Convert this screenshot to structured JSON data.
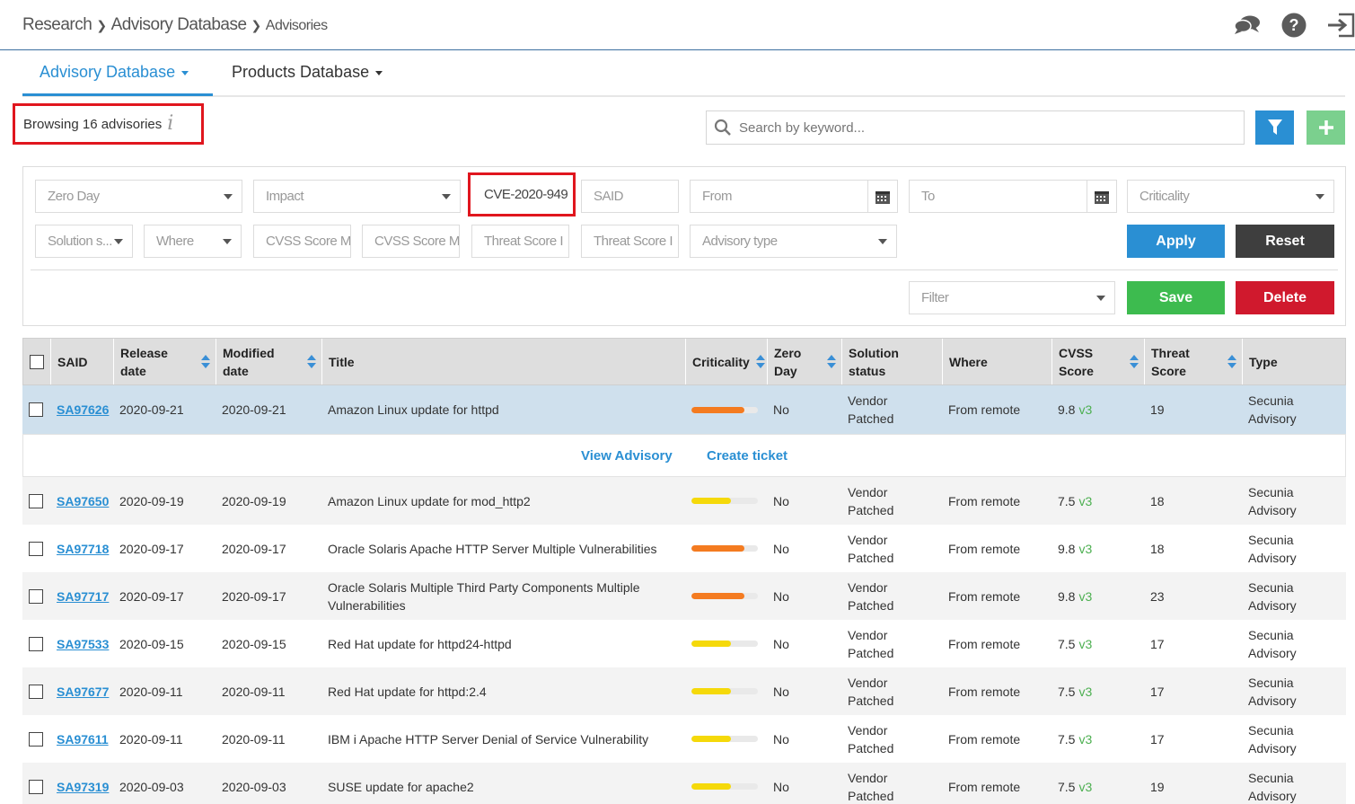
{
  "breadcrumb": {
    "items": [
      "Research",
      "Advisory Database",
      "Advisories"
    ]
  },
  "header_icons": [
    "chat-bubbles-icon",
    "help-icon",
    "logout-icon"
  ],
  "tabs": [
    {
      "label": "Advisory Database",
      "active": true
    },
    {
      "label": "Products Database",
      "active": false
    }
  ],
  "browsing": {
    "text": "Browsing 16 advisories",
    "info_icon": "i"
  },
  "search": {
    "placeholder": "Search by keyword..."
  },
  "filters": {
    "zero_day": "Zero Day",
    "impact": "Impact",
    "cve": "CVE-2020-949",
    "said": "SAID",
    "from": "From",
    "to": "To",
    "criticality": "Criticality",
    "solution_status": "Solution s...",
    "where": "Where",
    "cvss_min": "CVSS Score M",
    "cvss_max": "CVSS Score M",
    "threat_min": "Threat Score I",
    "threat_max": "Threat Score I",
    "advisory_type": "Advisory type",
    "saved_filter": "Filter"
  },
  "buttons": {
    "apply": "Apply",
    "reset": "Reset",
    "save": "Save",
    "delete": "Delete"
  },
  "table": {
    "headers": {
      "said": "SAID",
      "release": "Release date",
      "modified": "Modified date",
      "title": "Title",
      "criticality": "Criticality",
      "zero_day": "Zero Day",
      "solution": "Solution status",
      "where": "Where",
      "cvss": "CVSS Score",
      "threat": "Threat Score",
      "type": "Type"
    },
    "actions": {
      "view": "View Advisory",
      "ticket": "Create ticket"
    },
    "rows": [
      {
        "said": "SA97626",
        "release": "2020-09-21",
        "modified": "2020-09-21",
        "title": "Amazon Linux update for httpd",
        "crit_level": 0.8,
        "crit_color": "#f47b20",
        "zero_day": "No",
        "solution": "Vendor Patched",
        "where": "From remote",
        "cvss": "9.8",
        "cvss_ver": "v3",
        "threat": "19",
        "type": "Secunia Advisory"
      },
      {
        "said": "SA97650",
        "release": "2020-09-19",
        "modified": "2020-09-19",
        "title": "Amazon Linux update for mod_http2",
        "crit_level": 0.6,
        "crit_color": "#f5d90a",
        "zero_day": "No",
        "solution": "Vendor Patched",
        "where": "From remote",
        "cvss": "7.5",
        "cvss_ver": "v3",
        "threat": "18",
        "type": "Secunia Advisory"
      },
      {
        "said": "SA97718",
        "release": "2020-09-17",
        "modified": "2020-09-17",
        "title": "Oracle Solaris Apache HTTP Server Multiple Vulnerabilities",
        "crit_level": 0.8,
        "crit_color": "#f47b20",
        "zero_day": "No",
        "solution": "Vendor Patched",
        "where": "From remote",
        "cvss": "9.8",
        "cvss_ver": "v3",
        "threat": "18",
        "type": "Secunia Advisory"
      },
      {
        "said": "SA97717",
        "release": "2020-09-17",
        "modified": "2020-09-17",
        "title": "Oracle Solaris Multiple Third Party Components Multiple Vulnerabilities",
        "crit_level": 0.8,
        "crit_color": "#f47b20",
        "zero_day": "No",
        "solution": "Vendor Patched",
        "where": "From remote",
        "cvss": "9.8",
        "cvss_ver": "v3",
        "threat": "23",
        "type": "Secunia Advisory"
      },
      {
        "said": "SA97533",
        "release": "2020-09-15",
        "modified": "2020-09-15",
        "title": "Red Hat update for httpd24-httpd",
        "crit_level": 0.6,
        "crit_color": "#f5d90a",
        "zero_day": "No",
        "solution": "Vendor Patched",
        "where": "From remote",
        "cvss": "7.5",
        "cvss_ver": "v3",
        "threat": "17",
        "type": "Secunia Advisory"
      },
      {
        "said": "SA97677",
        "release": "2020-09-11",
        "modified": "2020-09-11",
        "title": "Red Hat update for httpd:2.4",
        "crit_level": 0.6,
        "crit_color": "#f5d90a",
        "zero_day": "No",
        "solution": "Vendor Patched",
        "where": "From remote",
        "cvss": "7.5",
        "cvss_ver": "v3",
        "threat": "17",
        "type": "Secunia Advisory"
      },
      {
        "said": "SA97611",
        "release": "2020-09-11",
        "modified": "2020-09-11",
        "title": "IBM i Apache HTTP Server Denial of Service Vulnerability",
        "crit_level": 0.6,
        "crit_color": "#f5d90a",
        "zero_day": "No",
        "solution": "Vendor Patched",
        "where": "From remote",
        "cvss": "7.5",
        "cvss_ver": "v3",
        "threat": "17",
        "type": "Secunia Advisory"
      },
      {
        "said": "SA97319",
        "release": "2020-09-03",
        "modified": "2020-09-03",
        "title": "SUSE update for apache2",
        "crit_level": 0.6,
        "crit_color": "#f5d90a",
        "zero_day": "No",
        "solution": "Vendor Patched",
        "where": "From remote",
        "cvss": "7.5",
        "cvss_ver": "v3",
        "threat": "19",
        "type": "Secunia Advisory"
      }
    ]
  },
  "colors": {
    "accent": "#2a8fd3",
    "highlight": "#e0161e",
    "save": "#3dbb4f",
    "delete": "#d0192d",
    "reset": "#3e3e3e",
    "selected_row": "#cfe0ed"
  }
}
